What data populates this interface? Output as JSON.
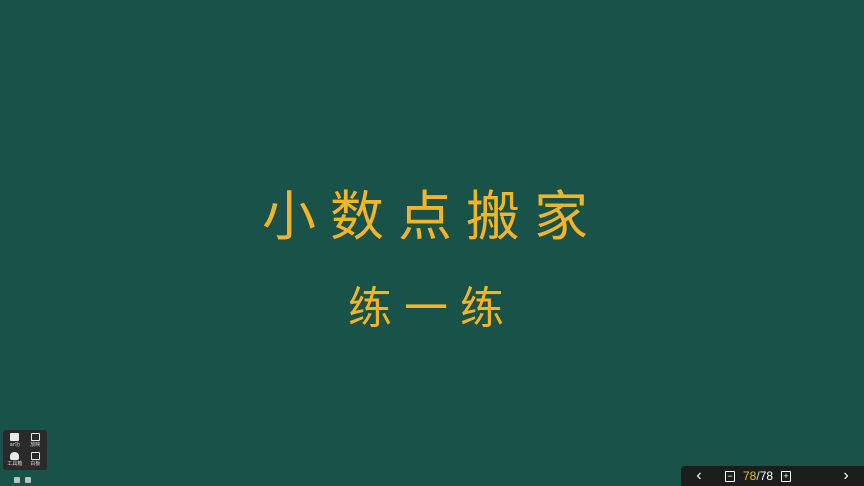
{
  "slide": {
    "title": "小数点搬家",
    "subtitle": "练一练",
    "text_color": "#f1b52a",
    "background": "#195249"
  },
  "toolbox": {
    "items": [
      {
        "icon": "camera-icon",
        "label": "ar功"
      },
      {
        "icon": "monitor-icon",
        "label": "放映"
      },
      {
        "icon": "pen-icon",
        "label": "工具箱"
      },
      {
        "icon": "screen-icon",
        "label": "白板"
      }
    ]
  },
  "pager": {
    "current": "78",
    "separator": "/",
    "total": "78",
    "prev_icon": "chevron-left-icon",
    "next_icon": "chevron-right-icon",
    "zoom_out_icon": "minus-box-icon",
    "zoom_in_icon": "plus-box-icon"
  }
}
